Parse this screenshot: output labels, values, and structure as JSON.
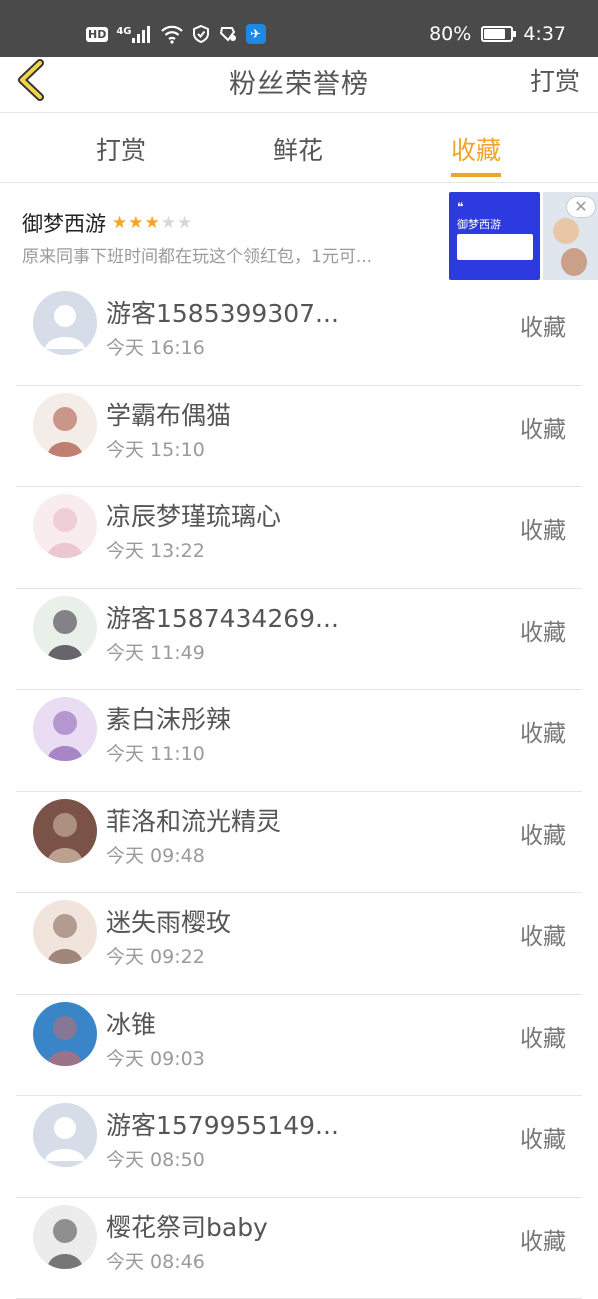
{
  "status_bar": {
    "hd": "HD",
    "network": "4G",
    "battery": "80%",
    "battery_level": 0.8,
    "time": "4:37"
  },
  "nav": {
    "title": "粉丝荣誉榜",
    "right_label": "打赏"
  },
  "tabs": [
    {
      "label": "打赏",
      "active": false
    },
    {
      "label": "鲜花",
      "active": false
    },
    {
      "label": "收藏",
      "active": true
    }
  ],
  "ad": {
    "title": "御梦西游",
    "rating": 3,
    "rating_max": 5,
    "description": "原来同事下班时间都在玩这个领红包，1元可...",
    "image_title": "御梦西游",
    "close_glyph": "✕"
  },
  "records": [
    {
      "name": "游客1585399307...",
      "time": "今天 16:16",
      "action": "收藏",
      "avatar": "default",
      "colors": [
        "#d6dde9",
        "#ffffff"
      ]
    },
    {
      "name": "学霸布偶猫",
      "time": "今天 15:10",
      "action": "收藏",
      "avatar": "custom",
      "colors": [
        "#f4ece6",
        "#a7513d"
      ]
    },
    {
      "name": "凉辰梦瑾琉璃心",
      "time": "今天 13:22",
      "action": "收藏",
      "avatar": "custom",
      "colors": [
        "#f8ecef",
        "#e8b8c3"
      ]
    },
    {
      "name": "游客1587434269...",
      "time": "今天 11:49",
      "action": "收藏",
      "avatar": "custom",
      "colors": [
        "#e9f0ea",
        "#2f2a35"
      ]
    },
    {
      "name": "素白沫彤辣",
      "time": "今天 11:10",
      "action": "收藏",
      "avatar": "custom",
      "colors": [
        "#e9dcf3",
        "#8a5fb2"
      ]
    },
    {
      "name": "菲洛和流光精灵",
      "time": "今天 09:48",
      "action": "收藏",
      "avatar": "custom",
      "colors": [
        "#7a5248",
        "#d9c3b1"
      ]
    },
    {
      "name": "迷失雨樱玫",
      "time": "今天 09:22",
      "action": "收藏",
      "avatar": "custom",
      "colors": [
        "#f1e4dd",
        "#7e5e51"
      ]
    },
    {
      "name": "冰锥",
      "time": "今天 09:03",
      "action": "收藏",
      "avatar": "custom",
      "colors": [
        "#3a84c8",
        "#c46d6d"
      ]
    },
    {
      "name": "游客1579955149...",
      "time": "今天 08:50",
      "action": "收藏",
      "avatar": "default",
      "colors": [
        "#d6dde9",
        "#ffffff"
      ]
    },
    {
      "name": "樱花祭司baby",
      "time": "今天 08:46",
      "action": "收藏",
      "avatar": "custom",
      "colors": [
        "#ececec",
        "#444444"
      ]
    }
  ]
}
